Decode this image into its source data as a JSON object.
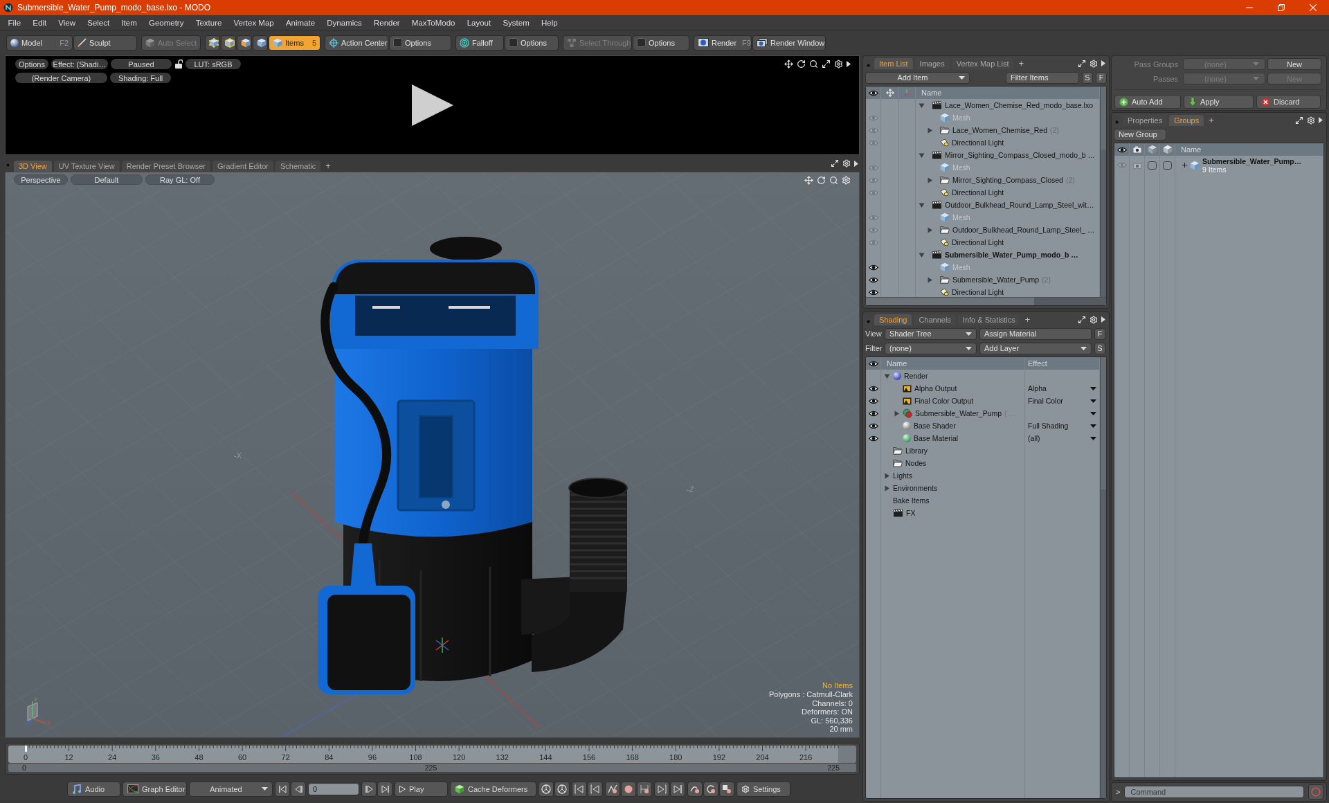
{
  "window": {
    "title": "Submersible_Water_Pump_modo_base.lxo - MODO"
  },
  "menu": [
    "File",
    "Edit",
    "View",
    "Select",
    "Item",
    "Geometry",
    "Texture",
    "Vertex Map",
    "Animate",
    "Dynamics",
    "Render",
    "MaxToModo",
    "Layout",
    "System",
    "Help"
  ],
  "toolbar": {
    "modes": [
      {
        "label": "Model",
        "shortcut": "F2"
      },
      {
        "label": "Sculpt"
      }
    ],
    "auto_select": {
      "label": "Auto Select",
      "disabled": true
    },
    "selection_types": [
      {
        "selected": false
      },
      {
        "selected": false
      },
      {
        "selected": false
      },
      {
        "selected": false
      },
      {
        "label": "Items",
        "shortcut": "5",
        "selected": true
      }
    ],
    "tools": [
      {
        "label": "Action Center",
        "disabled": false
      },
      {
        "label": "Options",
        "disabled": false
      },
      {
        "label": "Falloff",
        "disabled": false
      },
      {
        "label": "Options",
        "disabled": false
      },
      {
        "label": "Select Through",
        "disabled": true
      },
      {
        "label": "Options",
        "disabled": false
      }
    ],
    "render": [
      {
        "label": "Render",
        "shortcut": "F9"
      },
      {
        "label": "Render Window"
      }
    ]
  },
  "render_preview": {
    "options": "Options",
    "effect": "Effect: (Shadi…",
    "state": "Paused",
    "locked": false,
    "lut": "LUT: sRGB",
    "camera": "(Render Camera)",
    "shading": "Shading: Full"
  },
  "viewport": {
    "tabs": [
      {
        "label": "3D View",
        "selected": true
      },
      {
        "label": "UV Texture View",
        "selected": false
      },
      {
        "label": "Render Preset Browser",
        "selected": false
      },
      {
        "label": "Gradient Editor",
        "selected": false
      },
      {
        "label": "Schematic",
        "selected": false
      }
    ],
    "add_tab": "+",
    "view_buttons": [
      "Perspective",
      "Default",
      "Ray GL: Off"
    ],
    "axis_labels": [
      "-X",
      "-Z"
    ],
    "status": "No Items",
    "info": [
      "Polygons : Catmull-Clark",
      "Channels: 0",
      "Deformers: ON",
      "GL: 560,336",
      "20 mm"
    ],
    "gizmo_labels": [
      "Y",
      "X"
    ]
  },
  "timeline": {
    "ticks": [
      "0",
      "12",
      "24",
      "36",
      "48",
      "60",
      "72",
      "84",
      "96",
      "108",
      "120",
      "132",
      "144",
      "156",
      "168",
      "180",
      "192",
      "204",
      "216"
    ],
    "range": [
      "0",
      "225",
      "225"
    ]
  },
  "playback": {
    "audio": "Audio",
    "graph_editor": "Graph Editor",
    "mode": "Animated",
    "frame": "0",
    "play": "Play",
    "cache": "Cache Deformers",
    "settings": "Settings"
  },
  "item_list": {
    "tabs": [
      {
        "label": "Item List",
        "selected": true
      },
      {
        "label": "Images",
        "selected": false
      },
      {
        "label": "Vertex Map List",
        "selected": false
      }
    ],
    "add_tab": "+",
    "add_item": "Add Item",
    "filter": {
      "placeholder": "Filter Items"
    },
    "buttons": [
      "S",
      "F"
    ],
    "name_header": "Name",
    "scenes": [
      {
        "name": "Lace_Women_Chemise_Red_modo_base.lxo",
        "current": false,
        "expanded": true,
        "children": [
          {
            "kind": "mesh",
            "name": "Mesh",
            "visible": true
          },
          {
            "kind": "group",
            "name": "Lace_Women_Chemise_Red",
            "count": "(2)",
            "expanded": false,
            "visible": true
          },
          {
            "kind": "light",
            "name": "Directional Light",
            "visible": true
          }
        ]
      },
      {
        "name": "Mirror_Sighting_Compass_Closed_modo_b …",
        "current": false,
        "expanded": true,
        "children": [
          {
            "kind": "mesh",
            "name": "Mesh",
            "visible": true
          },
          {
            "kind": "group",
            "name": "Mirror_Sighting_Compass_Closed",
            "count": "(2)",
            "expanded": false,
            "visible": true
          },
          {
            "kind": "light",
            "name": "Directional Light",
            "visible": true
          }
        ]
      },
      {
        "name": "Outdoor_Bulkhead_Round_Lamp_Steel_wit…",
        "current": false,
        "expanded": true,
        "children": [
          {
            "kind": "mesh",
            "name": "Mesh",
            "visible": true
          },
          {
            "kind": "group",
            "name": "Outdoor_Bulkhead_Round_Lamp_Steel_ …",
            "expanded": false,
            "visible": true
          },
          {
            "kind": "light",
            "name": "Directional Light",
            "visible": true
          }
        ]
      },
      {
        "name": "Submersible_Water_Pump_modo_b …",
        "current": true,
        "expanded": true,
        "children": [
          {
            "kind": "mesh",
            "name": "Mesh",
            "visible": true
          },
          {
            "kind": "group",
            "name": "Submersible_Water_Pump",
            "count": "(2)",
            "expanded": false,
            "visible": true
          },
          {
            "kind": "light",
            "name": "Directional Light",
            "visible": true
          }
        ]
      }
    ]
  },
  "shading": {
    "tabs": [
      {
        "label": "Shading",
        "selected": true
      },
      {
        "label": "Channels",
        "selected": false
      },
      {
        "label": "Info & Statistics",
        "selected": false
      }
    ],
    "add_tab": "+",
    "view": {
      "label": "View",
      "value": "Shader Tree"
    },
    "assign": "Assign Material",
    "f": "F",
    "filter": {
      "label": "Filter",
      "value": "(none)"
    },
    "add_layer": "Add Layer",
    "s": "S",
    "columns": [
      "Name",
      "Effect"
    ],
    "items": [
      {
        "kind": "render",
        "name": "Render",
        "expanded": true,
        "children": [
          {
            "kind": "output",
            "name": "Alpha Output",
            "effect": "Alpha",
            "visible": true
          },
          {
            "kind": "output",
            "name": "Final Color Output",
            "effect": "Final Color",
            "visible": true
          },
          {
            "kind": "material",
            "name": "Submersible_Water_Pump",
            "suffix": "( …",
            "expanded": false,
            "visible": true
          },
          {
            "kind": "shader",
            "name": "Base Shader",
            "effect": "Full Shading",
            "visible": true
          },
          {
            "kind": "base_material",
            "name": "Base Material",
            "effect": "(all)",
            "visible": true
          }
        ]
      },
      {
        "kind": "folder",
        "name": "Library"
      },
      {
        "kind": "folder",
        "name": "Nodes"
      },
      {
        "kind": "plain",
        "name": "Lights",
        "expanded": false
      },
      {
        "kind": "plain",
        "name": "Environments",
        "expanded": false
      },
      {
        "kind": "plain",
        "name": "Bake Items"
      },
      {
        "kind": "clapper",
        "name": "FX"
      }
    ]
  },
  "passes": {
    "rows": [
      {
        "label": "Pass Groups",
        "value": "(none)",
        "button": "New",
        "disabled": false
      },
      {
        "label": "Passes",
        "value": "(none)",
        "button": "New",
        "disabled": true
      }
    ],
    "actions": [
      "Auto Add",
      "Apply",
      "Discard"
    ]
  },
  "groups": {
    "tabs": [
      {
        "label": "Properties",
        "selected": false
      },
      {
        "label": "Groups",
        "selected": true
      }
    ],
    "add_tab": "+",
    "new_group": "New Group",
    "name_header": "Name",
    "items": [
      {
        "name": "Submersible_Water_Pump…",
        "count": "9 Items",
        "expanded": false,
        "visible": true,
        "render": true,
        "column_3_on": false,
        "column_4_on": false
      }
    ]
  },
  "command": {
    "prompt": ">",
    "placeholder": "Command"
  }
}
